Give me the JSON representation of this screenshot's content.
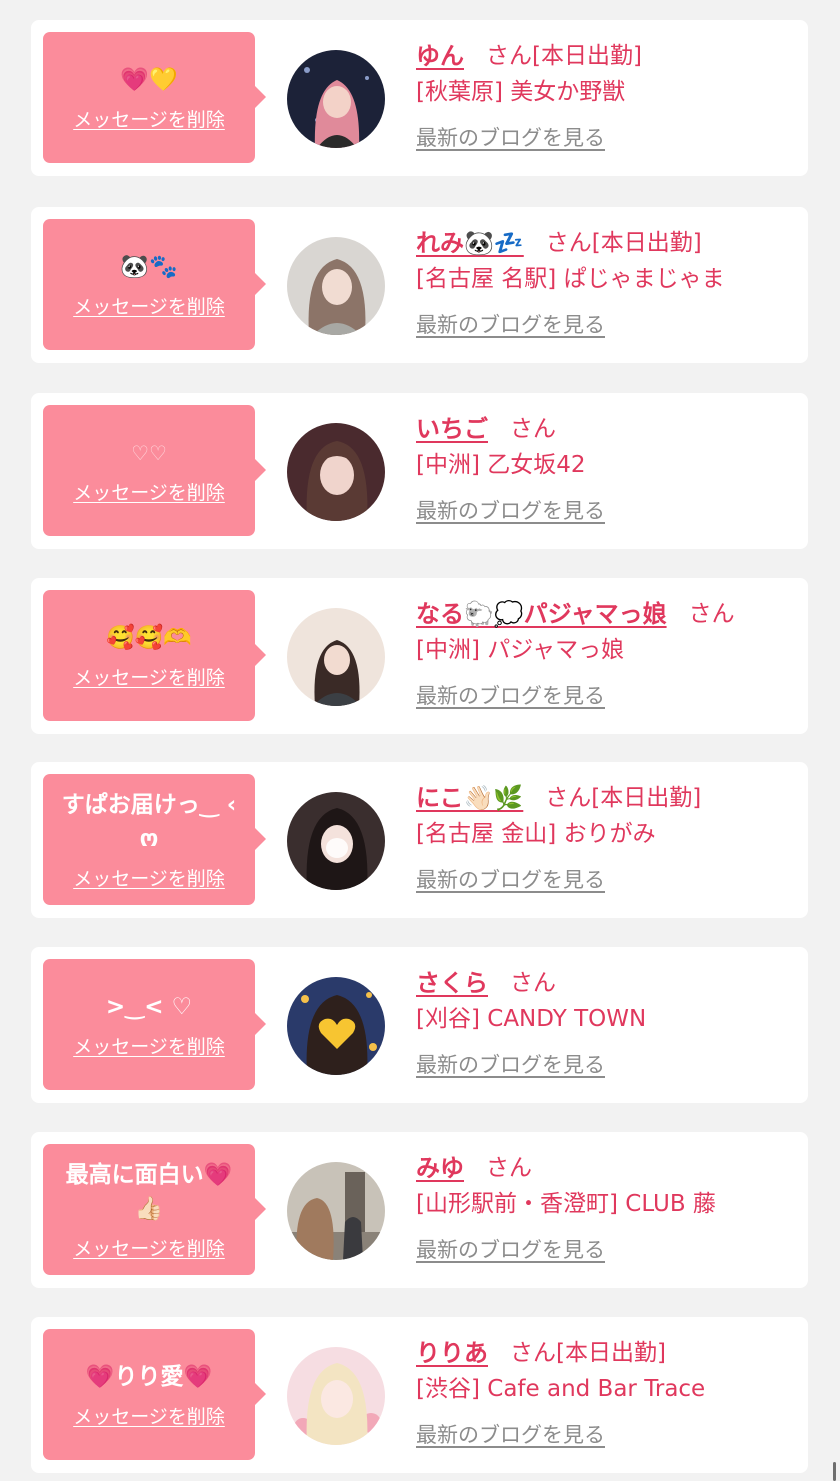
{
  "delete_label": "メッセージを削除",
  "blog_label": "最新のブログを見る",
  "colors": {
    "bubble": "#fb8c9b",
    "name": "#e0385d",
    "link_gray": "#8c8c8c",
    "page_bg": "#f2f2f2"
  },
  "cards": [
    {
      "message": "💗💛",
      "name": "ゆん",
      "suffix": "さん[本日出勤]",
      "shop": "[秋葉原] 美女か野獣",
      "avatar_icon": "pink-hair-portrait"
    },
    {
      "message": "🐼🐾",
      "name": "れみ🐼💤",
      "suffix": "さん[本日出勤]",
      "shop": "[名古屋 名駅] ぱじゃまじゃま",
      "avatar_icon": "ash-hair-portrait"
    },
    {
      "message": "♡♡",
      "name": "いちご",
      "suffix": "さん",
      "shop": "[中洲] 乙女坂42",
      "avatar_icon": "brown-hair-portrait"
    },
    {
      "message": "🥰🥰🫶",
      "name": "なる🐑💭パジャマっ娘",
      "suffix": "さん",
      "shop": "[中洲] パジャマっ娘",
      "avatar_icon": "pajama-girl-portrait"
    },
    {
      "message": "すぱお届けっ‿ ‹ ო",
      "name": "にこ👋🏻🌿",
      "suffix": "さん[本日出勤]",
      "shop": "[名古屋 金山] おりがみ",
      "avatar_icon": "blurred-face-portrait"
    },
    {
      "message": ">‿< ♡",
      "name": "さくら",
      "suffix": "さん",
      "shop": "[刈谷] CANDY TOWN",
      "avatar_icon": "heart-covered-portrait"
    },
    {
      "message": "最高に面白い💗👍🏻",
      "name": "みゆ",
      "suffix": "さん",
      "shop": "[山形駅前・香澄町] CLUB 藤",
      "avatar_icon": "street-photo-portrait"
    },
    {
      "message": "💗りり愛💗",
      "name": "りりあ",
      "suffix": "さん[本日出勤]",
      "shop": "[渋谷] Cafe and Bar Trace",
      "avatar_icon": "blonde-hair-portrait"
    }
  ]
}
